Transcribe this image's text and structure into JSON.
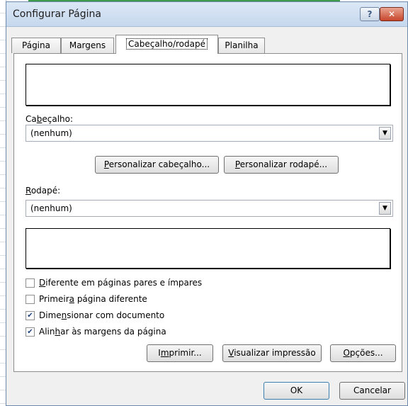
{
  "window": {
    "title": "Configurar Página",
    "help_label": "?",
    "close_label": "✕"
  },
  "tabs": [
    {
      "label": "Página"
    },
    {
      "label": "Margens"
    },
    {
      "label": "Cabeçalho/rodapé",
      "active": true
    },
    {
      "label": "Planilha"
    }
  ],
  "header": {
    "label_pre": "Ca",
    "label_key": "b",
    "label_post": "eçalho:",
    "value": "(nenhum)"
  },
  "buttons": {
    "custom_header_key": "P",
    "custom_header_rest": "ersonalizar cabeçalho...",
    "custom_footer_key": "P",
    "custom_footer_rest": "ersonalizar rodapé...",
    "print_pre": "I",
    "print_key": "m",
    "print_post": "primir...",
    "preview_key": "V",
    "preview_rest": "isualizar impressão",
    "options_key": "O",
    "options_rest": "pções...",
    "ok": "OK",
    "cancel": "Cancelar"
  },
  "footer": {
    "label_key": "R",
    "label_post": "odapé:",
    "value": "(nenhum)"
  },
  "options": [
    {
      "pre": "",
      "key": "D",
      "post": "iferente em páginas pares e ímpares",
      "checked": false
    },
    {
      "pre": "Primeir",
      "key": "a",
      "post": " página diferente",
      "checked": false
    },
    {
      "pre": "Dime",
      "key": "n",
      "post": "sionar com documento",
      "checked": true
    },
    {
      "pre": "Alin",
      "key": "h",
      "post": "ar às margens da página",
      "checked": true
    }
  ],
  "icons": {
    "dropdown": "chevron-down-icon",
    "check": "checkmark-icon"
  }
}
